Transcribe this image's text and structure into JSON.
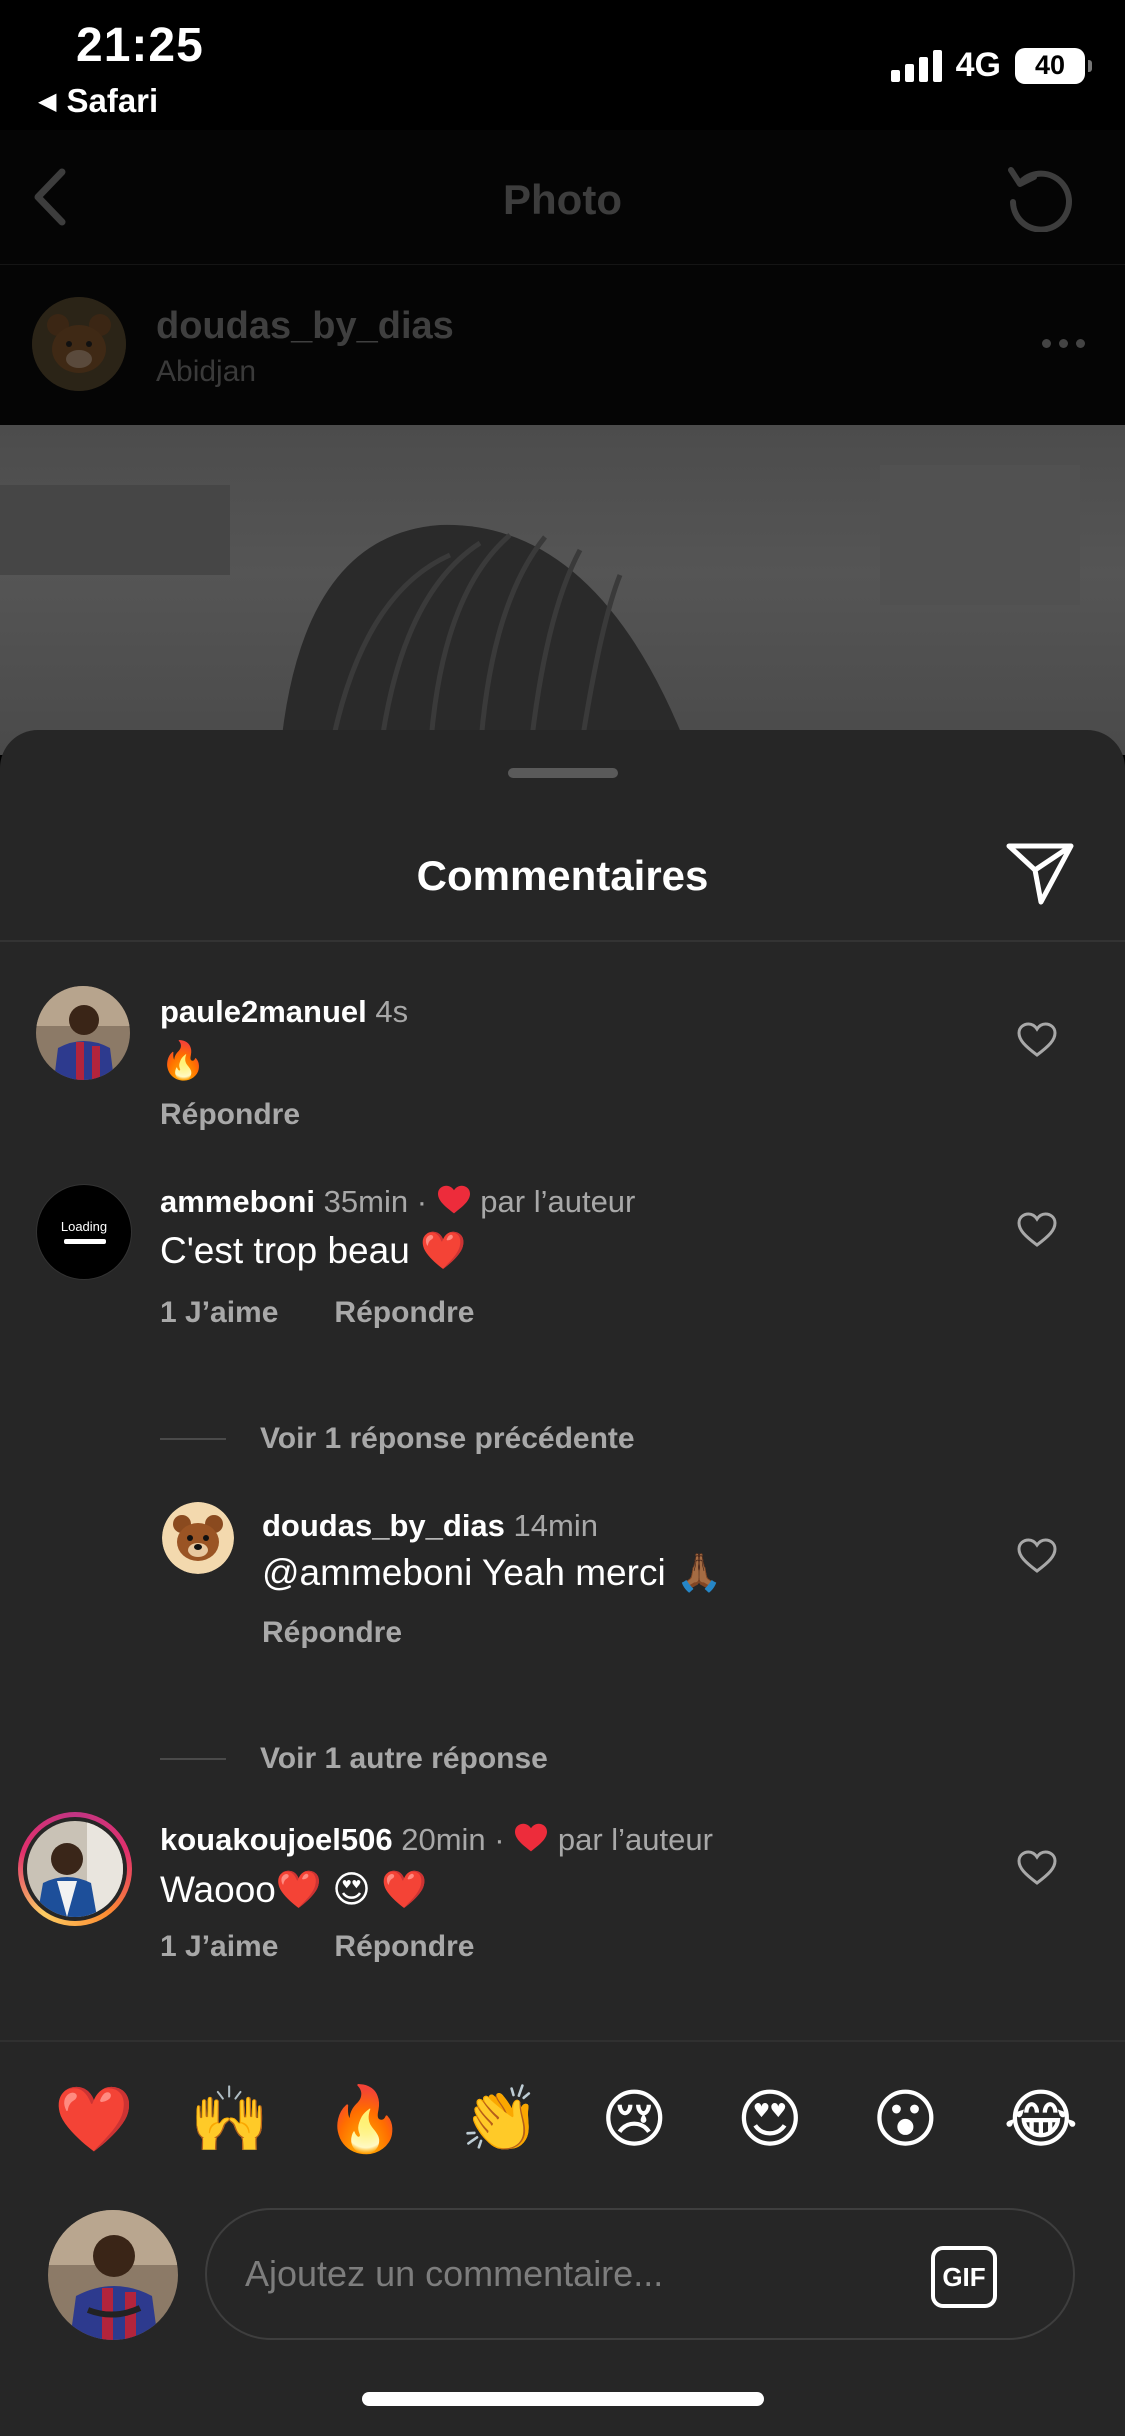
{
  "status_bar": {
    "time": "21:25",
    "back_app": "Safari",
    "network": "4G",
    "battery": "40"
  },
  "header": {
    "title": "Photo"
  },
  "post": {
    "username": "doudas_by_dias",
    "location": "Abidjan"
  },
  "sheet": {
    "title": "Commentaires"
  },
  "comments": [
    {
      "username": "paule2manuel",
      "time": "4s",
      "text": "🔥",
      "reply_label": "Répondre"
    },
    {
      "username": "ammeboni",
      "time": "35min",
      "liked_by_author": "par l’auteur",
      "text": "C'est trop beau ❤️",
      "likes_label": "1 J’aime",
      "reply_label": "Répondre",
      "avatar_text": "Loading"
    },
    {
      "username": "kouakoujoel506",
      "time": "20min",
      "liked_by_author": "par l’auteur",
      "text": "Waooo❤️ 😍 ❤️",
      "likes_label": "1 J’aime",
      "reply_label": "Répondre"
    }
  ],
  "previous_replies": "Voir 1 réponse précédente",
  "reply": {
    "username": "doudas_by_dias",
    "time": "14min",
    "text": "@ammeboni Yeah merci 🙏🏾",
    "reply_label": "Répondre"
  },
  "more_replies": "Voir 1 autre réponse",
  "emoji_bar": [
    "❤️",
    "🙌",
    "🔥",
    "👏",
    "😢",
    "😍",
    "😮",
    "😂"
  ],
  "composer": {
    "placeholder": "Ajoutez un commentaire...",
    "gif_label": "GIF"
  },
  "colors": {
    "sheet_background": "#262626",
    "heart_red": "#ed2c3b",
    "secondary_text": "#a8a8a8"
  }
}
